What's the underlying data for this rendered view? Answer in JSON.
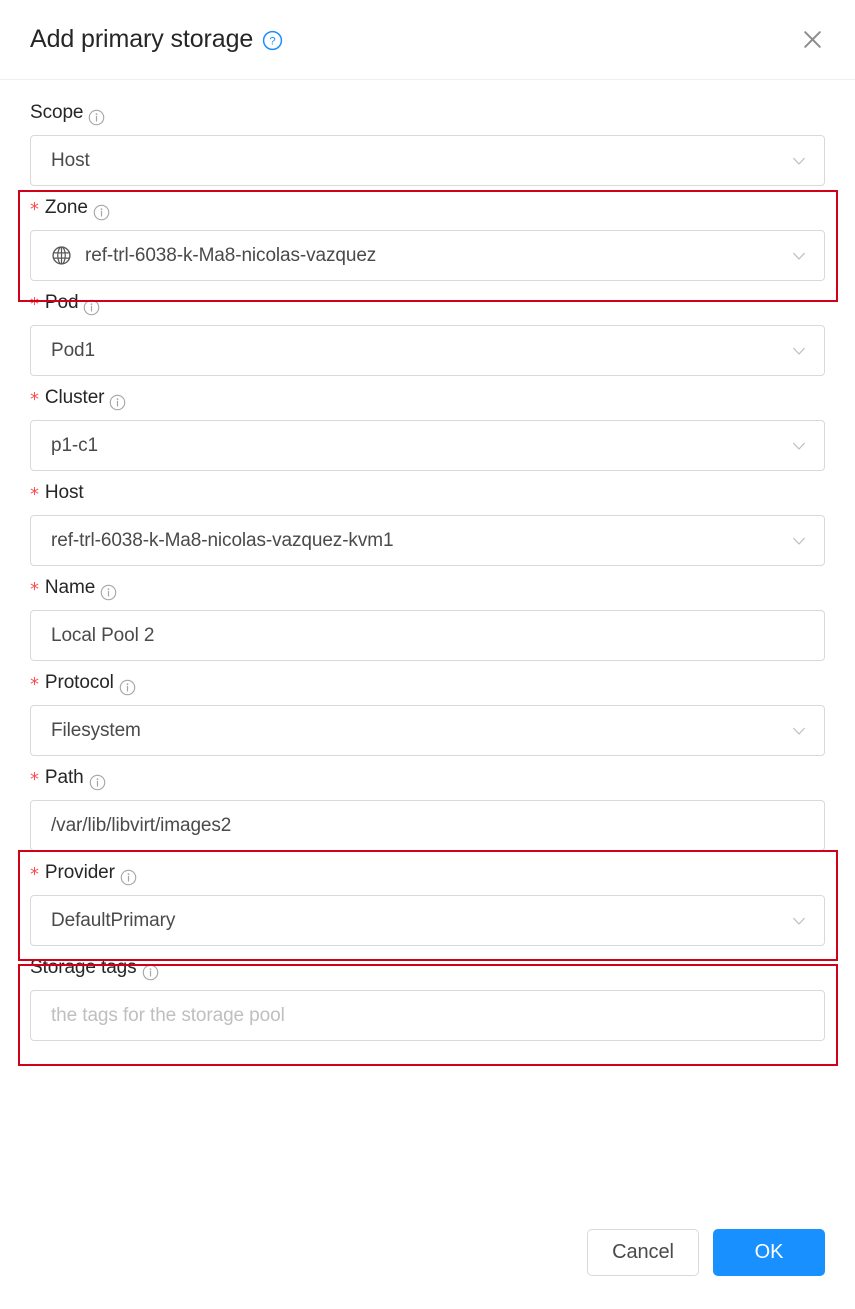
{
  "dialog": {
    "title": "Add primary storage",
    "help_icon": "question-circle-icon",
    "close_icon": "close-icon"
  },
  "fields": [
    {
      "id": "scope",
      "label": "Scope",
      "required": false,
      "info": true,
      "type": "select",
      "value": "Host",
      "highlighted": true
    },
    {
      "id": "zone",
      "label": "Zone",
      "required": true,
      "info": true,
      "type": "select",
      "value": "ref-trl-6038-k-Ma8-nicolas-vazquez",
      "icon": "globe-icon",
      "highlighted": false
    },
    {
      "id": "pod",
      "label": "Pod",
      "required": true,
      "info": true,
      "type": "select",
      "value": "Pod1",
      "highlighted": false
    },
    {
      "id": "cluster",
      "label": "Cluster",
      "required": true,
      "info": true,
      "type": "select",
      "value": "p1-c1",
      "highlighted": false
    },
    {
      "id": "host",
      "label": "Host",
      "required": true,
      "info": false,
      "type": "select",
      "value": "ref-trl-6038-k-Ma8-nicolas-vazquez-kvm1",
      "highlighted": false
    },
    {
      "id": "name",
      "label": "Name",
      "required": true,
      "info": true,
      "type": "input",
      "value": "Local Pool 2",
      "highlighted": false
    },
    {
      "id": "protocol",
      "label": "Protocol",
      "required": true,
      "info": true,
      "type": "select",
      "value": "Filesystem",
      "highlighted": true
    },
    {
      "id": "path",
      "label": "Path",
      "required": true,
      "info": true,
      "type": "input",
      "value": "/var/lib/libvirt/images2",
      "highlighted": true
    },
    {
      "id": "provider",
      "label": "Provider",
      "required": true,
      "info": true,
      "type": "select",
      "value": "DefaultPrimary",
      "highlighted": false
    },
    {
      "id": "storage-tags",
      "label": "Storage tags",
      "required": false,
      "info": true,
      "type": "input",
      "value": "",
      "placeholder": "the tags for the storage pool",
      "highlighted": false
    }
  ],
  "footer": {
    "cancel_label": "Cancel",
    "ok_label": "OK"
  },
  "colors": {
    "primary": "#1890ff",
    "required_star": "#ff4d4f",
    "annotation": "#d0021b",
    "border": "#d9d9d9",
    "text": "#262626",
    "placeholder": "#bfbfbf"
  }
}
